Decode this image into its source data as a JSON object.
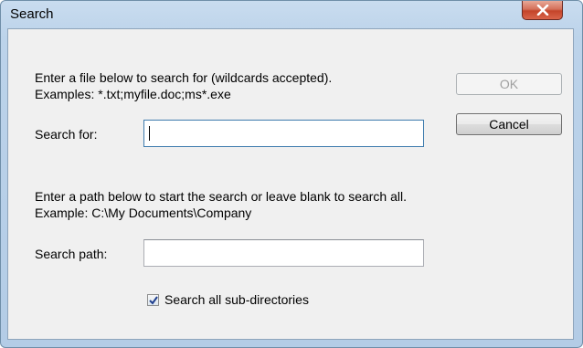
{
  "window": {
    "title": "Search"
  },
  "file_section": {
    "instruction": "Enter a file below to search for (wildcards accepted).",
    "examples": "Examples:  *.txt;myfile.doc;ms*.exe",
    "search_for_label": "Search for:",
    "search_for_value": ""
  },
  "path_section": {
    "instruction": "Enter a path below to start the search or leave blank to search all.",
    "example": "Example:  C:\\My Documents\\Company",
    "search_path_label": "Search path:",
    "search_path_value": ""
  },
  "options": {
    "subdirectories_label": "Search all sub-directories",
    "subdirectories_checked": true
  },
  "buttons": {
    "ok": "OK",
    "cancel": "Cancel"
  },
  "icons": {
    "close": "close-icon",
    "check": "check-icon"
  },
  "colors": {
    "close_button": "#c4442a",
    "focus_border": "#3d7bad",
    "title_bar": "#bcd3ea"
  }
}
